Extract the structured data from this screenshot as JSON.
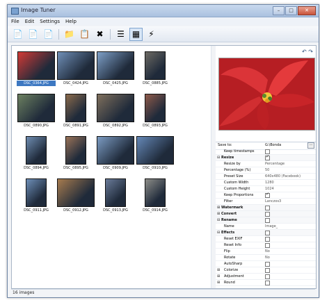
{
  "window": {
    "title": "Image Tuner"
  },
  "menu": [
    "File",
    "Edit",
    "Settings",
    "Help"
  ],
  "toolbar": {
    "buttons": [
      {
        "name": "new-icon",
        "glyph": "📄"
      },
      {
        "name": "add-icon",
        "glyph": "📄"
      },
      {
        "name": "page-icon",
        "glyph": "📄"
      },
      {
        "name": "folder-icon",
        "glyph": "📁"
      },
      {
        "name": "add-files-icon",
        "glyph": "📋"
      },
      {
        "name": "remove-icon",
        "glyph": "✖"
      },
      {
        "name": "list-view-icon",
        "glyph": "☰"
      },
      {
        "name": "thumbnail-view-icon",
        "glyph": "▦"
      },
      {
        "name": "process-icon",
        "glyph": "⚡"
      }
    ]
  },
  "thumbnails": [
    {
      "label": "DSC_0364.JPG",
      "selected": true,
      "shape": "wide",
      "color": "#d33a35"
    },
    {
      "label": "DSC_0424.JPG",
      "shape": "wide",
      "color": "#6f8fb7"
    },
    {
      "label": "DSC_0425.JPG",
      "shape": "wide",
      "color": "#7ea0c8"
    },
    {
      "label": "DSC_0885.JPG",
      "shape": "tall",
      "color": "#6d6a63"
    },
    {
      "label": "DSC_0890.JPG",
      "shape": "wide",
      "color": "#6c8060"
    },
    {
      "label": "DSC_0891.JPG",
      "shape": "tall",
      "color": "#8b6b4c"
    },
    {
      "label": "DSC_0892.JPG",
      "shape": "wide",
      "color": "#7f6f5c"
    },
    {
      "label": "DSC_0893.JPG",
      "shape": "tall",
      "color": "#8f5a4a"
    },
    {
      "label": "DSC_0894.JPG",
      "shape": "tall",
      "color": "#6f8db1"
    },
    {
      "label": "DSC_0895.JPG",
      "shape": "tall",
      "color": "#9a7358"
    },
    {
      "label": "DSC_0909.JPG",
      "shape": "wide",
      "color": "#7c9cc3"
    },
    {
      "label": "DSC_0910.JPG",
      "shape": "wide",
      "color": "#6588b7"
    },
    {
      "label": "DSC_0911.JPG",
      "shape": "tall",
      "color": "#6e8fb8"
    },
    {
      "label": "DSC_0912.JPG",
      "shape": "wide",
      "color": "#a77b4e"
    },
    {
      "label": "DSC_0913.JPG",
      "shape": "tall",
      "color": "#6a7b99"
    },
    {
      "label": "DSC_0914.JPG",
      "shape": "tall",
      "color": "#8d8d88"
    }
  ],
  "save_to": {
    "label": "Save to:",
    "value": "G:\\Bonda"
  },
  "properties": [
    {
      "type": "row",
      "label": "Keep timestamps",
      "value": "",
      "check": false
    },
    {
      "type": "group",
      "label": "Resize",
      "marker": "−",
      "check": true
    },
    {
      "type": "row",
      "label": "Resize by",
      "value": "Percentage"
    },
    {
      "type": "row",
      "label": "Percentage (%)",
      "value": "50"
    },
    {
      "type": "row",
      "label": "Preset Size",
      "value": "640x480 (Facebook)"
    },
    {
      "type": "row",
      "label": "Custom Width",
      "value": "1280"
    },
    {
      "type": "row",
      "label": "Custom Height",
      "value": "1024"
    },
    {
      "type": "row",
      "label": "Keep Proportions",
      "value": "",
      "check": true
    },
    {
      "type": "row",
      "label": "Filter",
      "value": "Lanczos3"
    },
    {
      "type": "group",
      "label": "Watermark",
      "marker": "+",
      "check": false
    },
    {
      "type": "group",
      "label": "Convert",
      "marker": "+",
      "check": false
    },
    {
      "type": "group",
      "label": "Rename",
      "marker": "−",
      "check": false
    },
    {
      "type": "row",
      "label": "Name",
      "value": "Image_"
    },
    {
      "type": "group",
      "label": "Effects",
      "marker": "−",
      "check": false
    },
    {
      "type": "row",
      "label": "Reset EXIF",
      "value": "",
      "check": false
    },
    {
      "type": "row",
      "label": "Reset Info",
      "value": "",
      "check": false
    },
    {
      "type": "row",
      "label": "Flip",
      "value": "No"
    },
    {
      "type": "row",
      "label": "Rotate",
      "value": "No"
    },
    {
      "type": "row",
      "label": "AutoSharp",
      "value": "",
      "check": false
    },
    {
      "type": "row",
      "label": "Colorize",
      "value": "",
      "check": false,
      "marker": "+"
    },
    {
      "type": "row",
      "label": "Adjustment",
      "value": "",
      "check": false,
      "marker": "+"
    },
    {
      "type": "row",
      "label": "Round",
      "value": "",
      "check": false,
      "marker": "+"
    }
  ],
  "status": "16 images"
}
